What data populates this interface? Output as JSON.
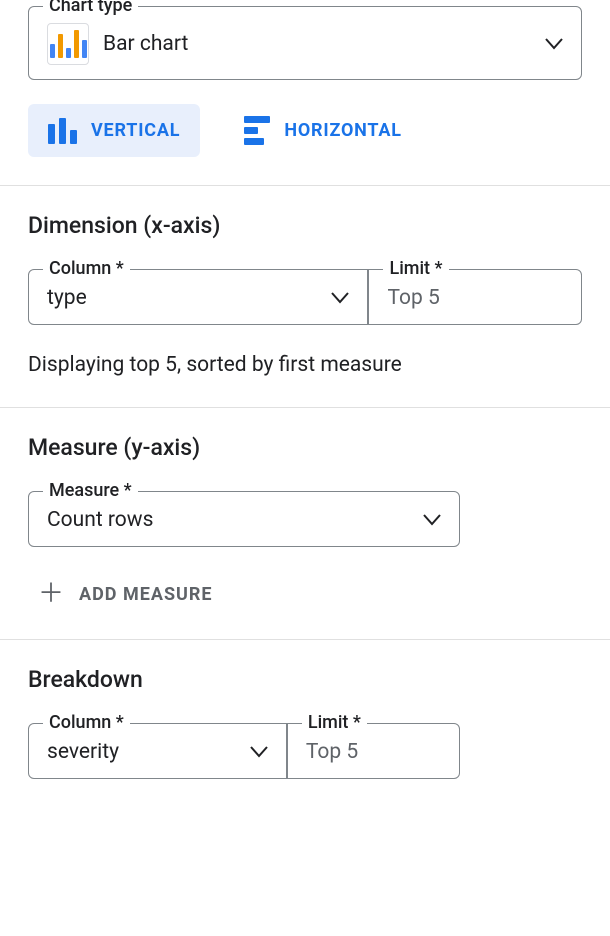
{
  "chart_type": {
    "label": "Chart type",
    "value": "Bar chart"
  },
  "orientation": {
    "vertical": "VERTICAL",
    "horizontal": "HORIZONTAL",
    "active": "vertical"
  },
  "dimension": {
    "title": "Dimension (x-axis)",
    "column_label": "Column *",
    "column_value": "type",
    "limit_label": "Limit *",
    "limit_value": "Top 5",
    "hint": "Displaying top 5, sorted by first measure"
  },
  "measure": {
    "title": "Measure (y-axis)",
    "label": "Measure *",
    "value": "Count rows",
    "add_label": "ADD MEASURE"
  },
  "breakdown": {
    "title": "Breakdown",
    "column_label": "Column *",
    "column_value": "severity",
    "limit_label": "Limit *",
    "limit_value": "Top 5"
  }
}
